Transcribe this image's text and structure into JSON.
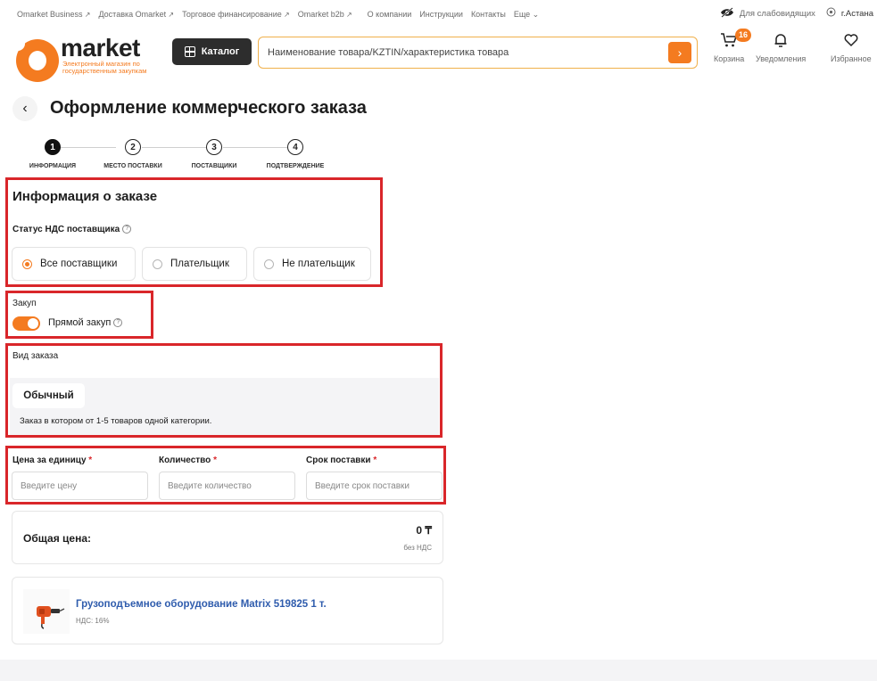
{
  "topbar": {
    "links": [
      "Omarket Business",
      "Доставка Omarket",
      "Торговое финансирование",
      "Omarket b2b"
    ],
    "plain_links": [
      "О компании",
      "Инструкции",
      "Контакты"
    ],
    "more": "Еще",
    "accessibility": "Для слабовидящих",
    "city": "г.Астана"
  },
  "header": {
    "logo_word": "market",
    "logo_sub": "Электронный магазин по государственным закупкам",
    "catalog_label": "Каталог",
    "search_placeholder": "Наименование товара/KZTIN/характеристика товара",
    "cart_label": "Корзина",
    "cart_count": "16",
    "notifications_label": "Уведомления",
    "favorites_label": "Избранное"
  },
  "page": {
    "title": "Оформление коммерческого заказа"
  },
  "steps": [
    {
      "num": "1",
      "label": "ИНФОРМАЦИЯ"
    },
    {
      "num": "2",
      "label": "МЕСТО ПОСТАВКИ"
    },
    {
      "num": "3",
      "label": "ПОСТАВЩИКИ"
    },
    {
      "num": "4",
      "label": "ПОДТВЕРЖДЕНИЕ"
    }
  ],
  "order_info": {
    "title": "Информация о заказе",
    "vat_label": "Статус НДС поставщика",
    "vat_options": [
      "Все поставщики",
      "Плательщик",
      "Не плательщик"
    ],
    "vat_selected": "Все поставщики"
  },
  "procurement": {
    "label": "Закуп",
    "toggle_label": "Прямой закуп",
    "toggle_on": true
  },
  "order_type": {
    "label": "Вид заказа",
    "selected": "Обычный",
    "description": "Заказ в котором от 1-5 товаров одной категории."
  },
  "fields": [
    {
      "label": "Цена за единицу",
      "placeholder": "Введите цену"
    },
    {
      "label": "Количество",
      "placeholder": "Введите количество"
    },
    {
      "label": "Срок поставки",
      "placeholder": "Введите срок поставки"
    }
  ],
  "total": {
    "label": "Общая цена:",
    "value": "0 ₸",
    "note": "без НДС"
  },
  "product": {
    "title": "Грузоподъемное оборудование Matrix 519825 1 т.",
    "vat": "НДС: 16%"
  },
  "colors": {
    "accent": "#f47b20",
    "highlight": "#d9262a",
    "link": "#2f5cad"
  }
}
